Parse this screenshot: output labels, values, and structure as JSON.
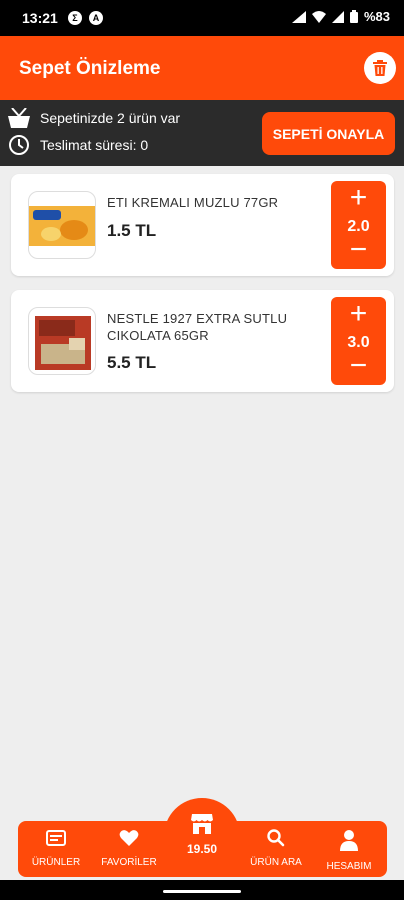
{
  "status_bar": {
    "time": "13:21",
    "notif1": "Σ",
    "notif2": "A",
    "battery": "%83"
  },
  "header": {
    "title": "Sepet Önizleme"
  },
  "cart_info": {
    "items_text": "Sepetinizde 2 ürün var",
    "delivery_text": "Teslimat süresi: 0",
    "confirm_label": "SEPETİ ONAYLA"
  },
  "products": [
    {
      "name": "ETI KREMALI MUZLU 77GR",
      "price": "1.5 TL",
      "quantity": "2.0",
      "thumb_color": "#f3b23a"
    },
    {
      "name": "NESTLE 1927 EXTRA SUTLU CIKOLATA 65GR",
      "price": "5.5 TL",
      "quantity": "3.0",
      "thumb_color": "#b93a25"
    }
  ],
  "bottom_nav": {
    "products_label": "ÜRÜNLER",
    "favorites_label": "FAVORİLER",
    "total": "19.50",
    "search_label": "ÜRÜN ARA",
    "account_label": "HESABIM"
  },
  "colors": {
    "accent": "#ff4a0a",
    "dark_bar": "#2b2b2b"
  }
}
